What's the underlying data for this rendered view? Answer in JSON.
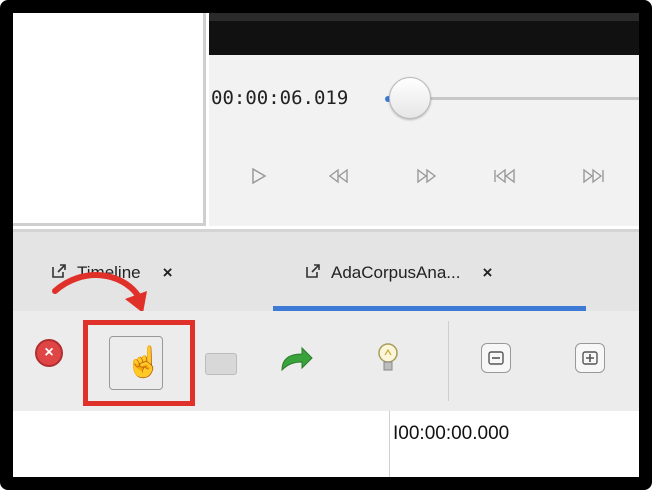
{
  "player": {
    "timecode": "00:00:06.019",
    "controls": [
      "play-icon",
      "step-back-icon",
      "step-forward-icon",
      "skip-to-start-icon",
      "skip-to-end-icon"
    ]
  },
  "tabs": [
    {
      "label": "Timeline",
      "close": "×",
      "active": false
    },
    {
      "label": "AdaCorpusAna...",
      "close": "×",
      "active": true
    }
  ],
  "toolbar": {
    "icons": [
      "stop-icon",
      "color-palette-hand-icon",
      "gray-rect-icon",
      "redo-arrow-icon",
      "lightbulb-icon",
      "zoom-out-icon",
      "zoom-in-icon"
    ]
  },
  "bottom": {
    "timecode": "I00:00:00.000"
  },
  "colors": {
    "highlight": "#e0302a",
    "active_tab_underline": "#3d7ad6",
    "redo_arrow": "#3aa23a"
  }
}
